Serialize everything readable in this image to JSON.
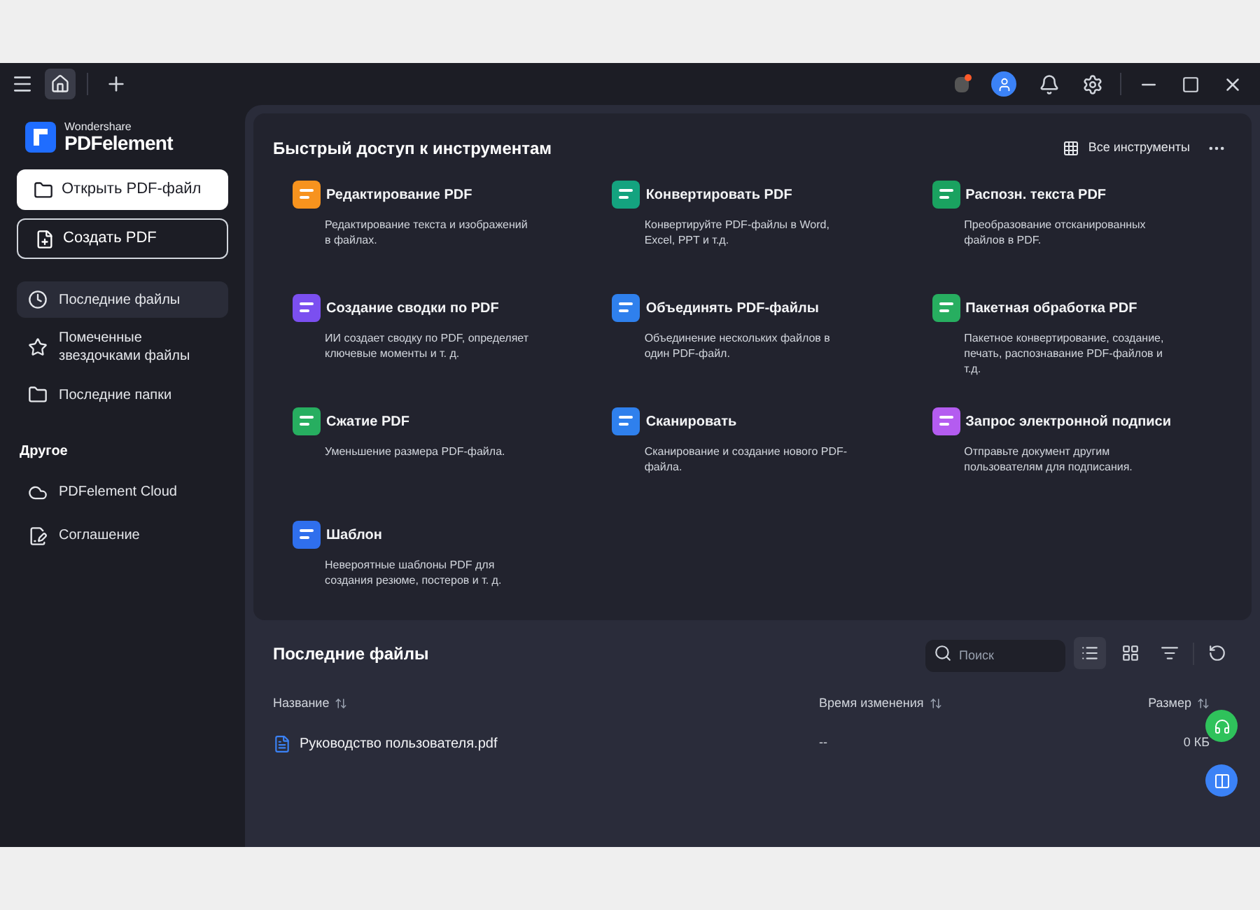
{
  "titlebar": {
    "home_tab": {
      "selected": true
    }
  },
  "sidebar": {
    "brand": {
      "vendor": "Wondershare",
      "product": "PDFelement"
    },
    "actions": [
      {
        "label": "Открыть PDF-файл",
        "kind": "primary"
      },
      {
        "label": "Создать PDF",
        "kind": "outline"
      }
    ],
    "items": [
      {
        "label": "Последние файлы",
        "kind": "clock",
        "selected": true
      },
      {
        "label": "Помеченные звездочками файлы",
        "kind": "star",
        "selected": false
      },
      {
        "label": "Последние папки",
        "kind": "folder",
        "selected": false
      }
    ],
    "section_title": "Другое",
    "other_items": [
      {
        "label": "PDFelement Cloud",
        "kind": "cloud"
      },
      {
        "label": "Соглашение",
        "kind": "doc"
      }
    ]
  },
  "tools": {
    "title": "Быстрый доступ к инструментам",
    "all_tools": "Все инструменты",
    "items": [
      {
        "title": "Редактирование PDF",
        "description": "Редактирование текста и изображений в файлах.",
        "color": "#f7931e"
      },
      {
        "title": "Конвертировать PDF",
        "description": "Конвертируйте PDF-файлы в Word, Excel, PPT и т.д.",
        "color": "#14a37f"
      },
      {
        "title": "Распозн. текста PDF",
        "description": "Преобразование отсканированных файлов в PDF.",
        "color": "#1aa260"
      },
      {
        "title": "Создание сводки по PDF",
        "description": "ИИ создает сводку по PDF, определяет ключевые моменты и т. д.",
        "color": "#7b4ff0"
      },
      {
        "title": "Объединять PDF-файлы",
        "description": "Объединение нескольких файлов в один PDF-файл.",
        "color": "#2f80ed"
      },
      {
        "title": "Пакетная обработка PDF",
        "description": "Пакетное конвертирование, создание, печать, распознавание PDF-файлов и т.д.",
        "color": "#27ae60"
      },
      {
        "title": "Сжатие PDF",
        "description": "Уменьшение размера PDF-файла.",
        "color": "#27ae60"
      },
      {
        "title": "Сканировать",
        "description": "Сканирование и создание нового PDF-файла.",
        "color": "#2f80ed"
      },
      {
        "title": "Запрос электронной подписи",
        "description": "Отправьте документ другим пользователям для подписания.",
        "color": "#b45cf0"
      },
      {
        "title": "Шаблон",
        "description": "Невероятные шаблоны PDF для создания резюме, постеров и т. д.",
        "color": "#2f6fed"
      }
    ]
  },
  "recent": {
    "title": "Последние файлы",
    "search": {
      "placeholder": "Поиск"
    },
    "view_buttons": [
      {
        "kind": "list",
        "selected": true
      },
      {
        "kind": "grid",
        "selected": false
      }
    ],
    "columns": [
      "Название",
      "Время изменения",
      "Размер"
    ],
    "rows": [
      {
        "name": "Руководство пользователя.pdf",
        "modified": "--",
        "size": "0 КБ"
      }
    ]
  }
}
